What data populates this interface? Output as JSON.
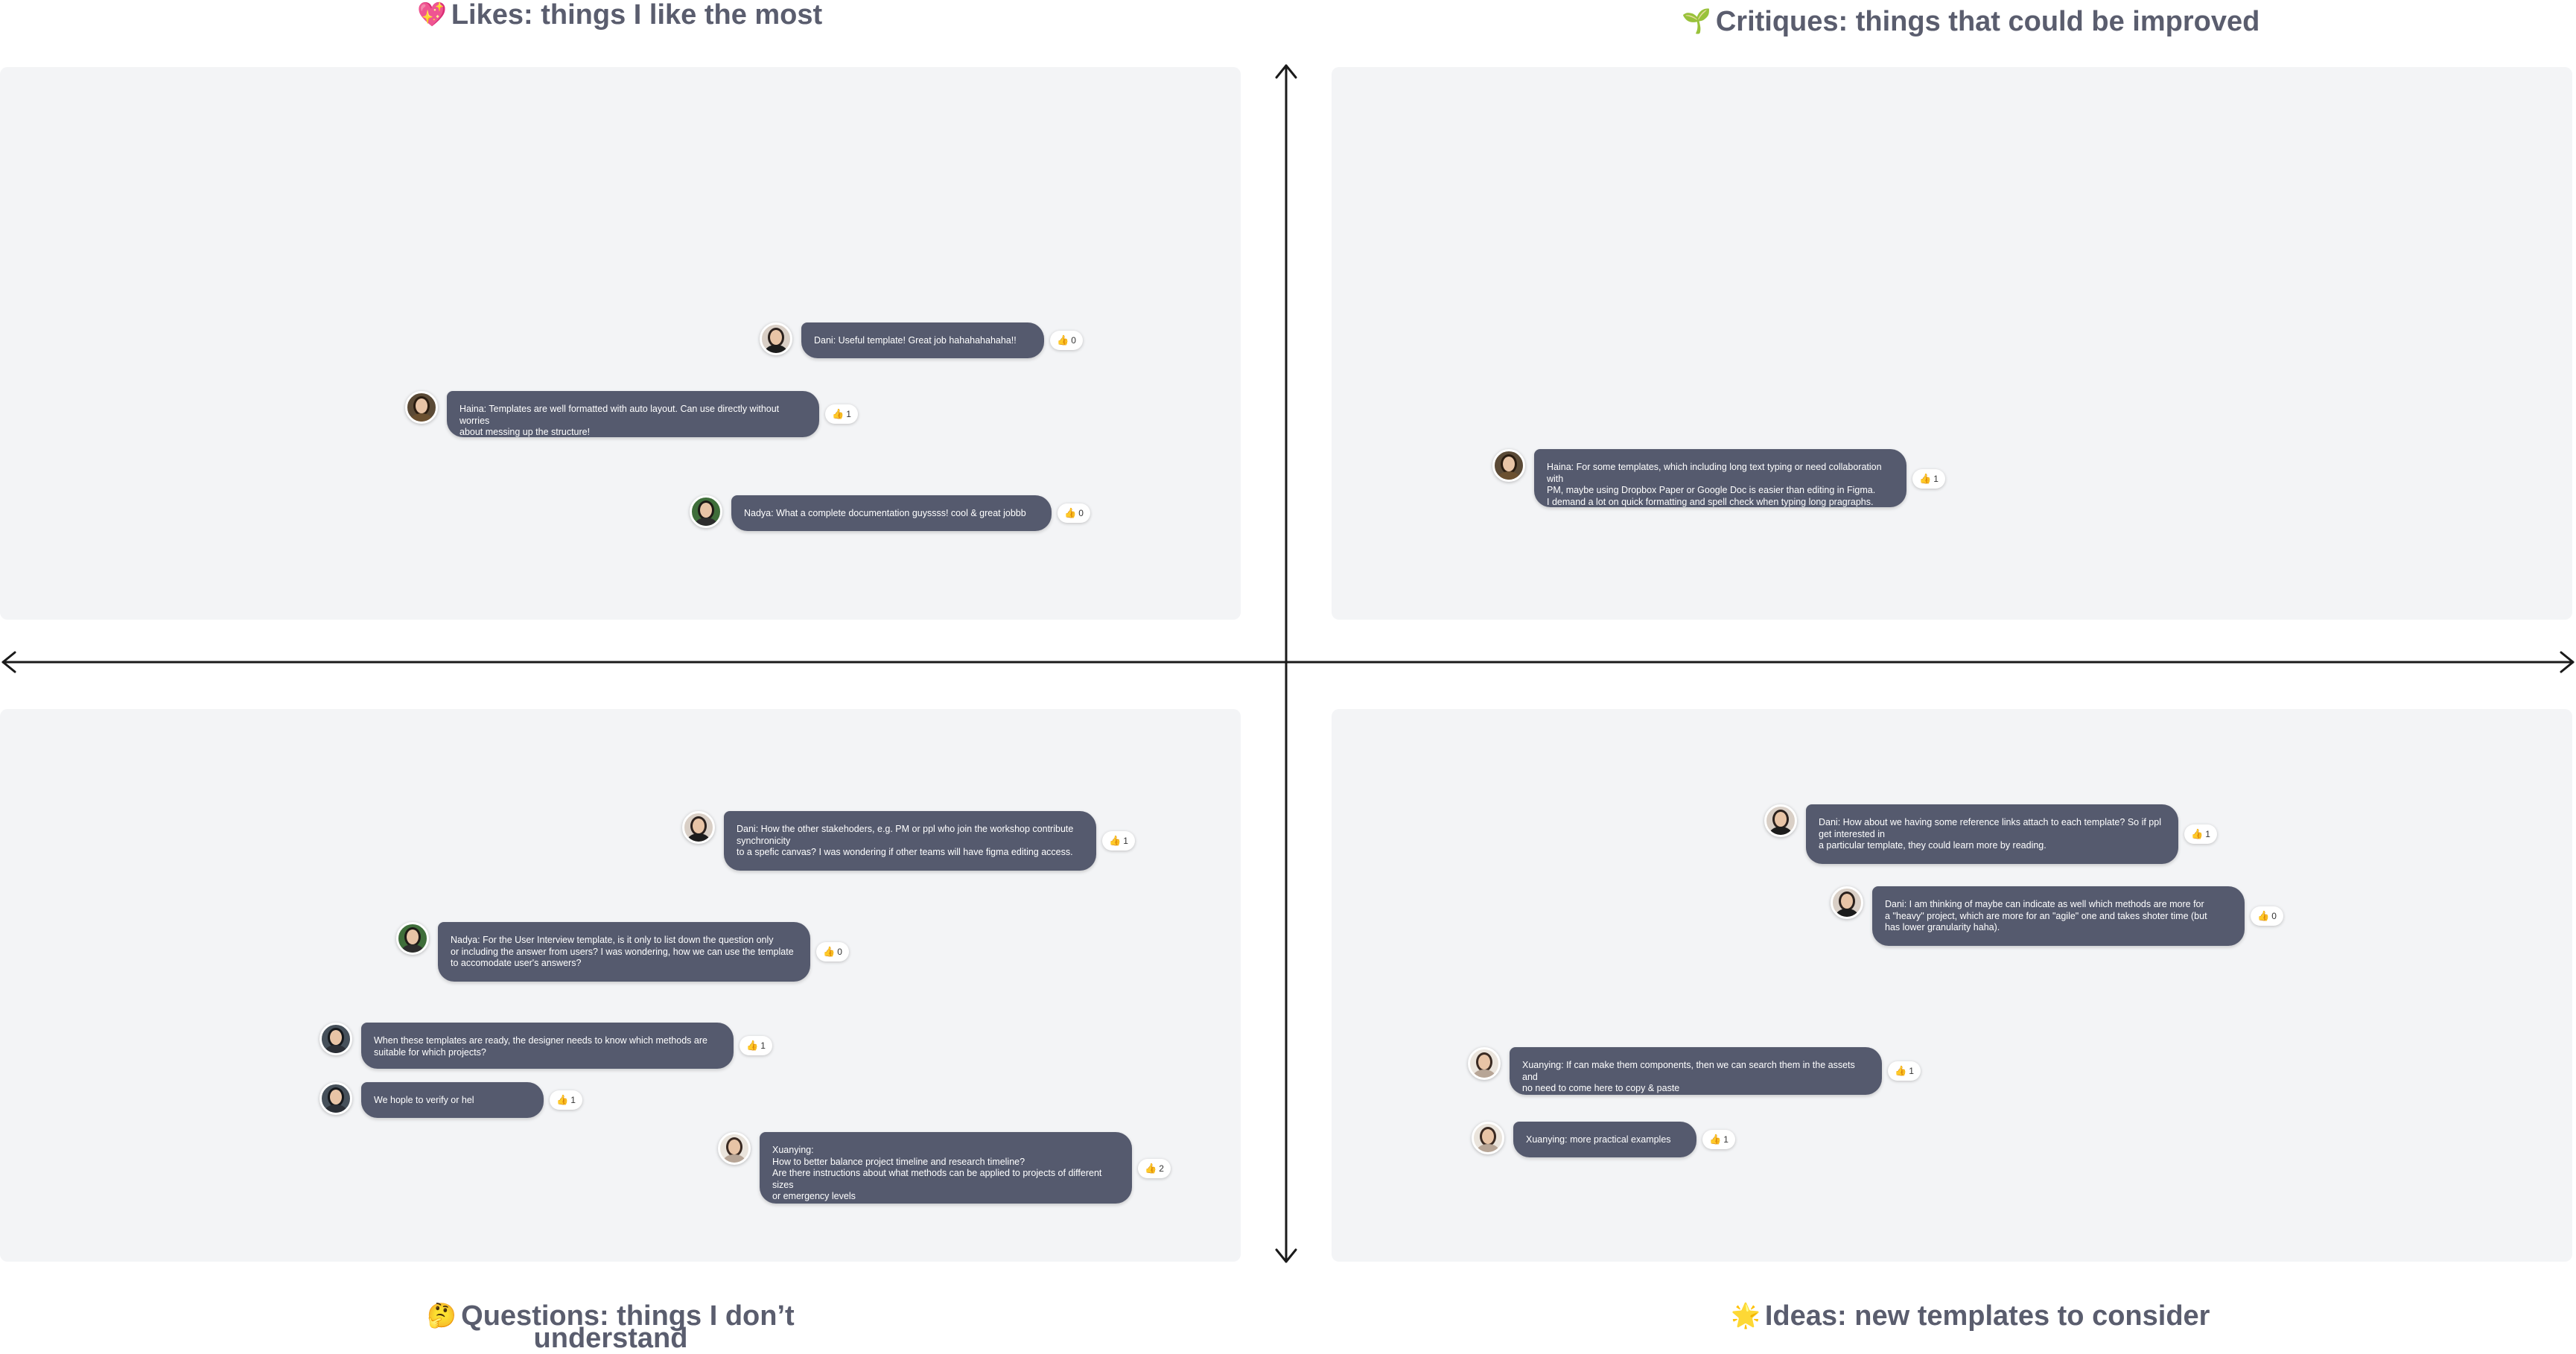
{
  "titles": {
    "likes": {
      "emoji": "💖",
      "text": "Likes: things I like the most"
    },
    "critiques": {
      "emoji": "🌱",
      "text": "Critiques: things that could be improved"
    },
    "questions": {
      "emoji": "🤔",
      "text": "Questions: things I don’t understand"
    },
    "ideas": {
      "emoji": "🌟",
      "text": "Ideas: new templates to consider"
    }
  },
  "notes": {
    "likes": [
      {
        "author": "Dani",
        "text": "Dani: Useful template! Great job hahahahahaha!!",
        "reactions": "0"
      },
      {
        "author": "Haina",
        "text": "Haina:  Templates are well formatted with auto layout. Can use directly without worries\nabout messing up the structure!",
        "reactions": "1"
      },
      {
        "author": "Nadya",
        "text": "Nadya: What a complete documentation guyssss! cool & great jobbb",
        "reactions": "0"
      }
    ],
    "critiques": [
      {
        "author": "Haina",
        "text": "Haina:  For some templates, which including long text typing or need collaboration with\nPM, maybe using Dropbox Paper or Google Doc is easier than editing in Figma.\nI demand a lot on quick formatting and spell check when typing long pragraphs.",
        "reactions": "1"
      }
    ],
    "questions": [
      {
        "author": "Dani",
        "text": "Dani: How the other stakehoders, e.g. PM or ppl who join the workshop contribute synchronicity\nto a spefic canvas? I was wondering if other teams will have figma editing access.",
        "reactions": "1"
      },
      {
        "author": "Nadya",
        "text": "Nadya: For the User Interview template, is it only to list down the question only\nor including the answer from users? I was wondering, how we can use the template\nto accomodate user's answers?",
        "reactions": "0"
      },
      {
        "author": "We",
        "text": "When these templates are ready, the designer needs to know which methods are\nsuitable for which projects?",
        "reactions": "1"
      },
      {
        "author": "We",
        "text": "We  hople to verify or hel",
        "reactions": "1"
      },
      {
        "author": "Xuanying",
        "text": "Xuanying:\nHow to better balance project timeline and research timeline?\nAre there instructions about what methods can be applied to projects of different sizes\nor emergency levels",
        "reactions": "2"
      }
    ],
    "ideas": [
      {
        "author": "Dani",
        "text": "Dani: How about we having some reference links attach to each template? So if ppl get interested in\na particular template, they could learn more by reading.",
        "reactions": "1"
      },
      {
        "author": "Dani",
        "text": "Dani: I am thinking of maybe can indicate as well which methods are more for\na \"heavy\" project, which are more for an \"agile\" one and takes shoter time (but\nhas lower granularity haha).",
        "reactions": "0"
      },
      {
        "author": "Xuanying",
        "text": "Xuanying: If can make them components, then we can search them in the assets and\nno need to come here to copy & paste",
        "reactions": "1"
      },
      {
        "author": "Xuanying",
        "text": "Xuanying: more practical examples",
        "reactions": "1"
      }
    ]
  },
  "reaction_icon": "thumbs-up-icon",
  "colors": {
    "background": "#ffffff",
    "quadrant": "#f3f4f6",
    "bubble": "#555a6e",
    "title": "#5a5d6e",
    "axis": "#1a1a1a",
    "reaction_thumb": "#f2b01e"
  }
}
